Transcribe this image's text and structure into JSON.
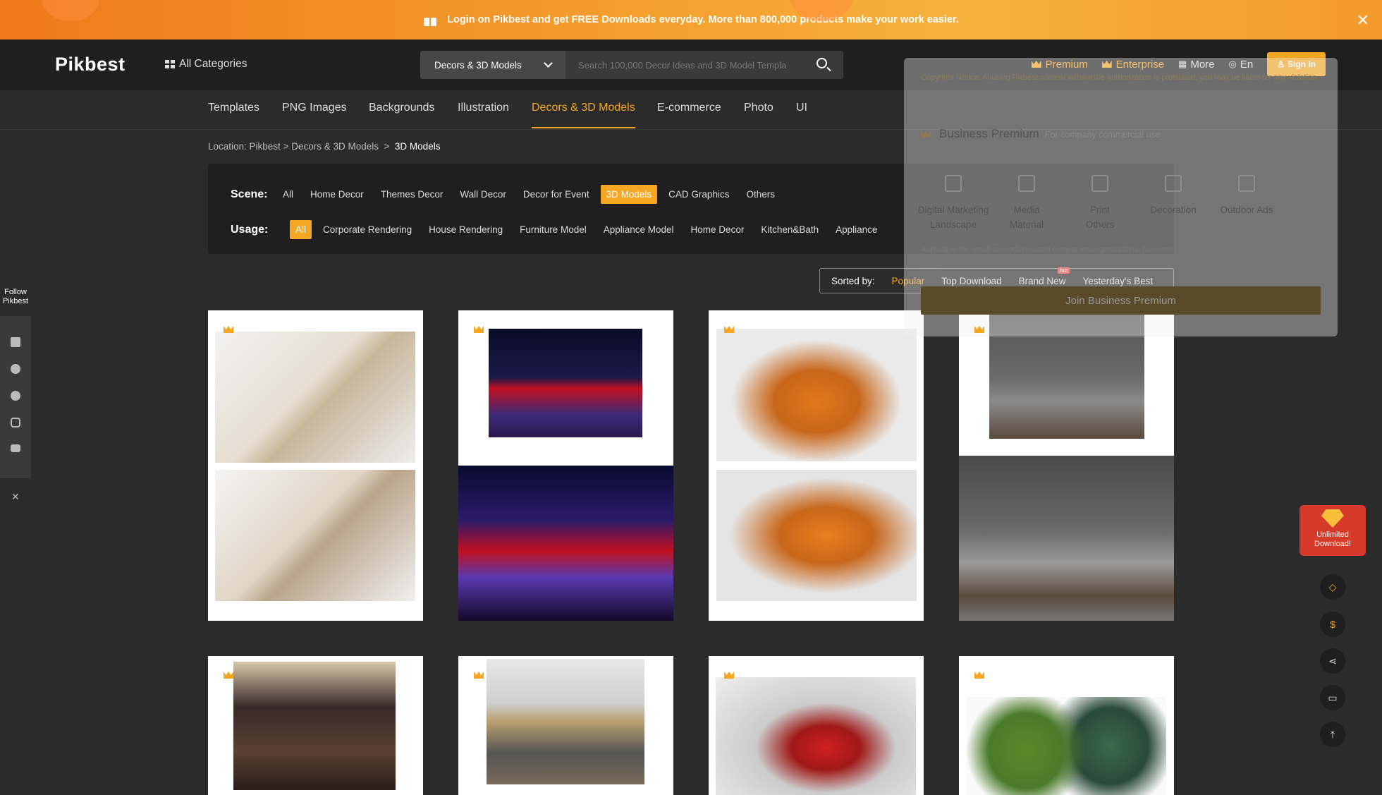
{
  "banner": {
    "text": "Login on Pikbest and get FREE Downloads everyday. More than 800,000 products make your work easier."
  },
  "header": {
    "logo": "Pikbest",
    "all_categories": "All Categories",
    "search_category": "Decors & 3D Models",
    "search_placeholder": "Search 100,000 Decor Ideas and 3D Model Templa",
    "premium": "Premium",
    "enterprise": "Enterprise",
    "more": "More",
    "lang": "En",
    "sign_in": "Sign In"
  },
  "nav": {
    "tabs": [
      {
        "label": "Templates"
      },
      {
        "label": "PNG Images"
      },
      {
        "label": "Backgrounds"
      },
      {
        "label": "Illustration"
      },
      {
        "label": "Decors & 3D Models"
      },
      {
        "label": "E-commerce"
      },
      {
        "label": "Photo"
      },
      {
        "label": "UI"
      }
    ],
    "active": "Decors & 3D Models"
  },
  "breadcrumb": {
    "prefix": "Location: Pikbest > Decors & 3D Models",
    "sep": ">",
    "current": "3D Models"
  },
  "filter": {
    "scene_label": "Scene:",
    "scene": [
      "All",
      "Home Decor",
      "Themes Decor",
      "Wall Decor",
      "Decor for Event",
      "3D Models",
      "CAD Graphics",
      "Others"
    ],
    "scene_selected": "3D Models",
    "usage_label": "Usage:",
    "usage": [
      "All",
      "Corporate Rendering",
      "House Rendering",
      "Furniture Model",
      "Appliance Model",
      "Home Decor",
      "Kitchen&Bath",
      "Appliance"
    ],
    "usage_selected": "All"
  },
  "sort": {
    "label": "Sorted by:",
    "options": [
      "Popular",
      "Top Download",
      "Brand New",
      "Yesterday's Best"
    ],
    "active": "Popular",
    "hot_badge": "hot"
  },
  "social": {
    "follow": "Follow Pikbest",
    "icons": [
      "facebook-icon",
      "twitter-icon",
      "pinterest-icon",
      "instagram-icon",
      "youtube-icon"
    ]
  },
  "float": {
    "unlimited": "Unlimited Download!"
  },
  "premium_dropdown": {
    "copyright": "Copyright Notice: Abusing Pikbest content without the authorization is prohibited, you may be liable for any violation.",
    "title": "Business Premium",
    "subtitle": "For company commercial use",
    "categories": [
      "Digital Marketing",
      "Media",
      "Print",
      "Decoration",
      "Outdoor Ads",
      "Landscape",
      "Material",
      "Others"
    ],
    "applicable": "Applicable for: small-to-medium-sized companies/organizations, business authorization of designers/agencies for clients",
    "join": "Join Business Premium"
  },
  "colors": {
    "accent": "#f5a623",
    "bg": "#2b2b2b",
    "header": "#1f1f1f"
  }
}
